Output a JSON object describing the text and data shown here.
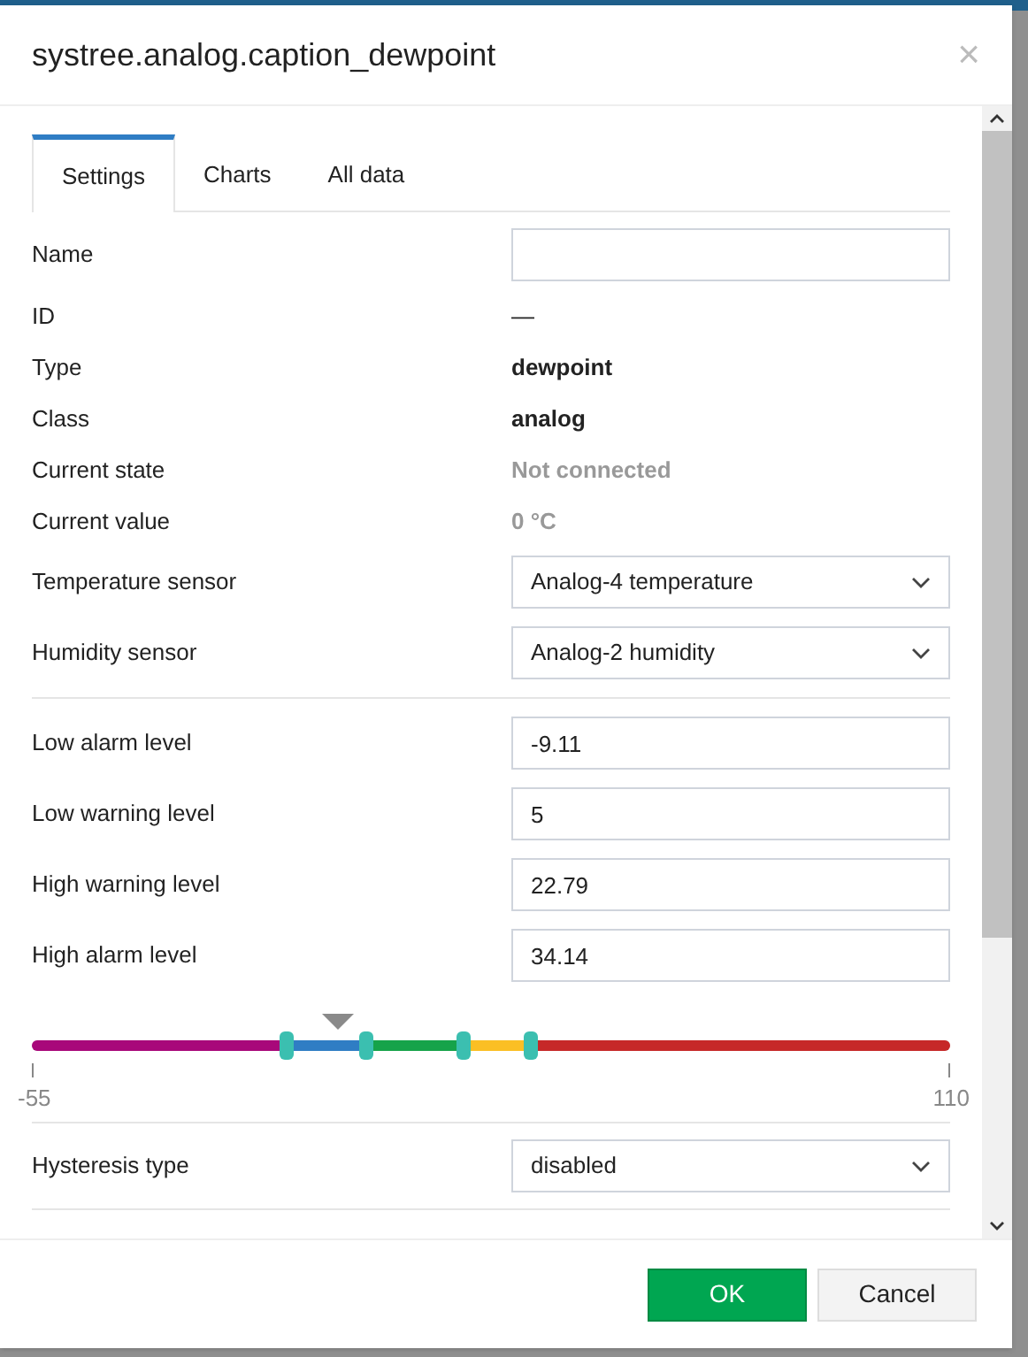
{
  "dialog": {
    "title": "systree.analog.caption_dewpoint",
    "close": "×"
  },
  "tabs": [
    {
      "label": "Settings",
      "selected": true
    },
    {
      "label": "Charts",
      "selected": false
    },
    {
      "label": "All data",
      "selected": false
    }
  ],
  "fields": [
    {
      "kind": "input",
      "label": "Name"
    },
    {
      "kind": "text",
      "label": "ID",
      "value": "—",
      "muted": false,
      "bold": false
    },
    {
      "kind": "text",
      "label": "Type",
      "value": "dewpoint",
      "muted": false,
      "bold": true
    },
    {
      "kind": "text",
      "label": "Class",
      "value": "analog",
      "muted": false,
      "bold": true
    },
    {
      "kind": "text",
      "label": "Current state",
      "value": "Not connected",
      "muted": true,
      "bold": true
    },
    {
      "kind": "text",
      "label": "Current value",
      "value": "0 °C",
      "muted": true,
      "bold": true
    },
    {
      "kind": "select",
      "label": "Temperature sensor",
      "value": "Analog-4 temperature"
    },
    {
      "kind": "select",
      "label": "Humidity sensor",
      "value": "Analog-2 humidity"
    }
  ],
  "levels": [
    {
      "label": "Low alarm level",
      "value": "-9.11"
    },
    {
      "label": "Low warning level",
      "value": "5"
    },
    {
      "label": "High warning level",
      "value": "22.79"
    },
    {
      "label": "High alarm level",
      "value": "34.14"
    }
  ],
  "scale": {
    "min": "-55",
    "max": "110",
    "current": {
      "level": 0.333
    },
    "thumbs": [
      {
        "level": 0.278
      },
      {
        "level": 0.364
      },
      {
        "level": 0.47
      },
      {
        "level": 0.543
      }
    ],
    "segments": [
      {
        "color": "#a8087a"
      },
      {
        "color": "#2f7dc4"
      },
      {
        "color": "#16a34a"
      },
      {
        "color": "#fbbf24"
      },
      {
        "color": "#c62828"
      }
    ]
  },
  "hysteresis": {
    "label": "Hysteresis type",
    "value": "disabled"
  },
  "buttons": [
    {
      "label": "OK",
      "kind": "primary"
    },
    {
      "label": "Cancel",
      "kind": "secondary"
    }
  ]
}
